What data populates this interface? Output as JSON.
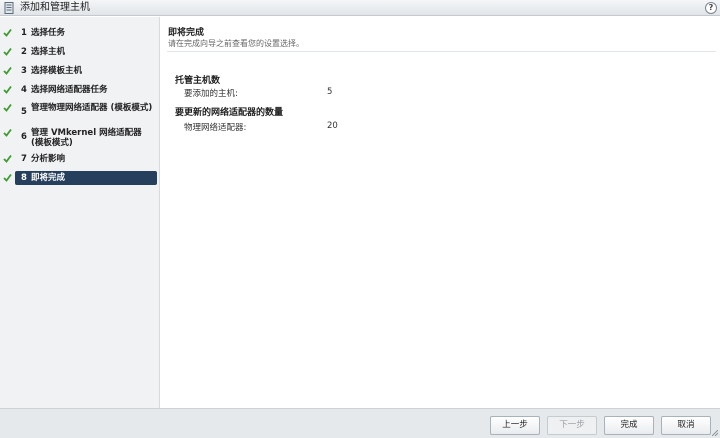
{
  "window": {
    "title": "添加和管理主机",
    "help": "?"
  },
  "sidebar": {
    "steps": [
      {
        "num": "1",
        "label": "选择任务",
        "done": true
      },
      {
        "num": "2",
        "label": "选择主机",
        "done": true
      },
      {
        "num": "3",
        "label": "选择模板主机",
        "done": true
      },
      {
        "num": "4",
        "label": "选择网络适配器任务",
        "done": true
      },
      {
        "num": "5",
        "label": "管理物理网络适配器 (模板模式)",
        "done": true
      },
      {
        "num": "6",
        "label": "管理 VMkernel 网络适配器 (模板模式)",
        "done": true
      },
      {
        "num": "7",
        "label": "分析影响",
        "done": true
      },
      {
        "num": "8",
        "label": "即将完成",
        "done": true,
        "active": true
      }
    ]
  },
  "main": {
    "title": "即将完成",
    "subtitle": "请在完成向导之前查看您的设置选择。",
    "sections": [
      {
        "heading": "托管主机数",
        "rows": [
          {
            "label": "要添加的主机:",
            "value": "5"
          }
        ]
      },
      {
        "heading": "要更新的网络适配器的数量",
        "rows": [
          {
            "label": "物理网络适配器:",
            "value": "20"
          }
        ]
      }
    ]
  },
  "footer": {
    "back": "上一步",
    "next": "下一步",
    "finish": "完成",
    "cancel": "取消"
  },
  "colors": {
    "check": "#3e9b2f",
    "active_bg": "#253f5c"
  }
}
